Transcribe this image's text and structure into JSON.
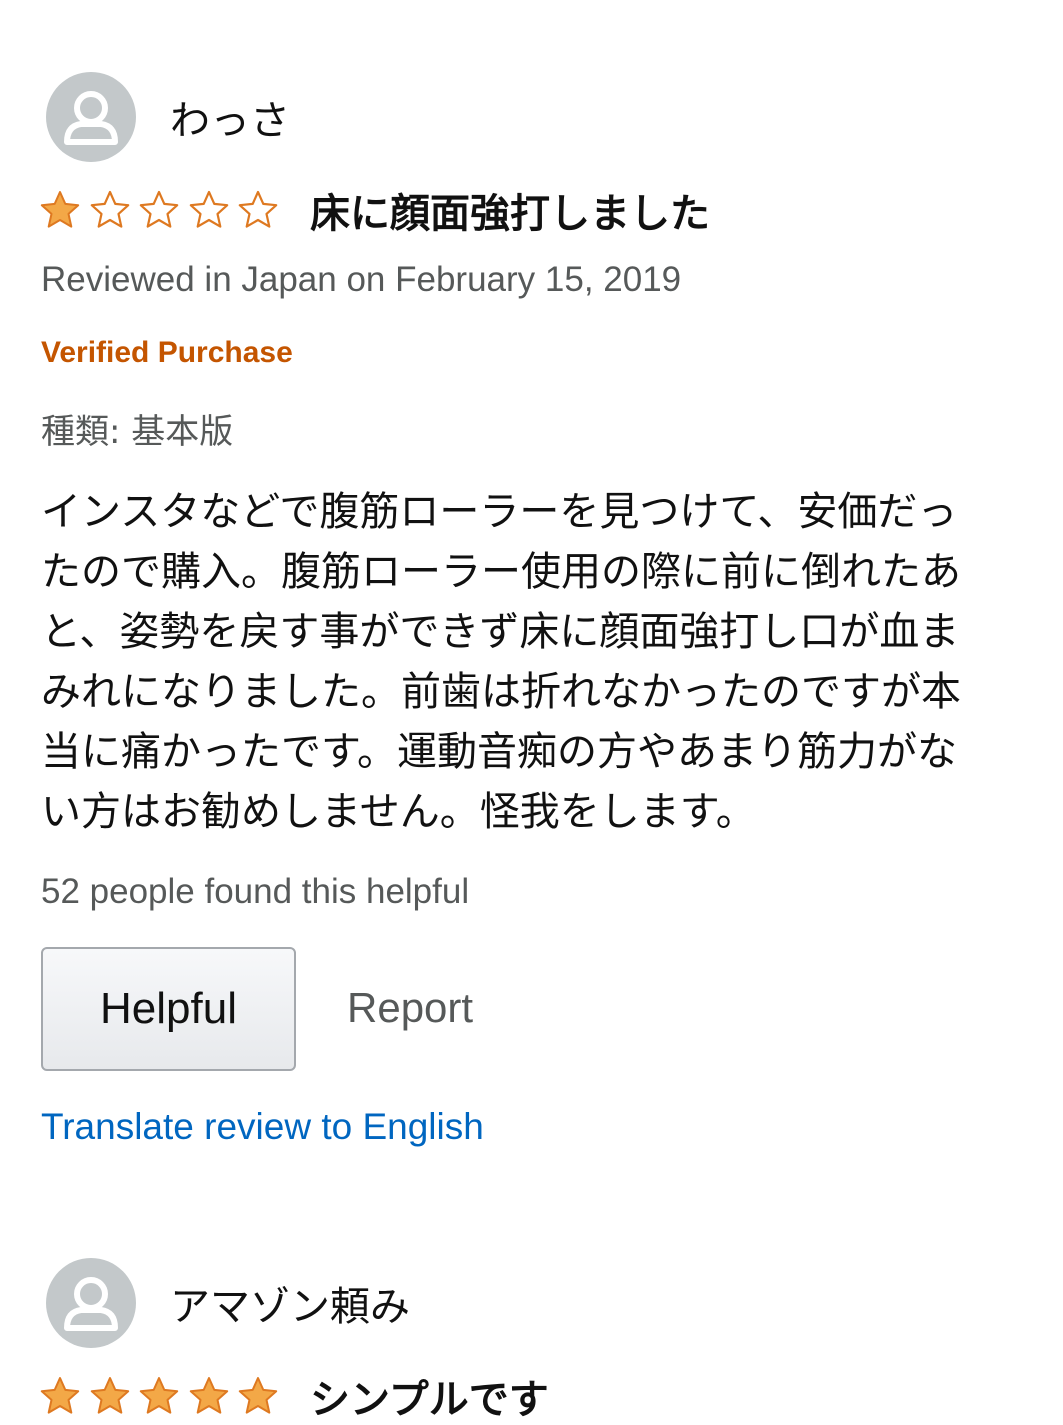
{
  "colors": {
    "star_filled": "#f3a847",
    "star_empty_stroke": "#de7921",
    "verified": "#c45500",
    "link": "#0066c0",
    "muted_text": "#565959",
    "avatar_bg": "#c3c8ca"
  },
  "reviews": [
    {
      "reviewer_name": "わっさ",
      "avatar_icon": "default-user-icon",
      "rating": 1,
      "max_rating": 5,
      "title": "床に顔面強打しました",
      "date_text": "Reviewed in Japan on February 15, 2019",
      "verified_label": "Verified Purchase",
      "variant": "種類: 基本版",
      "body_lines": [
        "インスタなどで腹筋ローラーを見つけて、安価だっ",
        "たので購入。腹筋ローラー使用の際に前に倒れたあ",
        "と、姿勢を戻す事ができず床に顔面強打し口が血ま",
        "みれになりました。前歯は折れなかったのですが本",
        "当に痛かったです。運動音痴の方やあまり筋力がな",
        "い方はお勧めしません。怪我をします。"
      ],
      "helpful_count_text": "52 people found this helpful",
      "helpful_button_label": "Helpful",
      "report_label": "Report",
      "translate_label": "Translate review to English"
    },
    {
      "reviewer_name": "アマゾン頼み",
      "avatar_icon": "default-user-icon",
      "rating": 5,
      "max_rating": 5,
      "title": "シンプルです"
    }
  ]
}
